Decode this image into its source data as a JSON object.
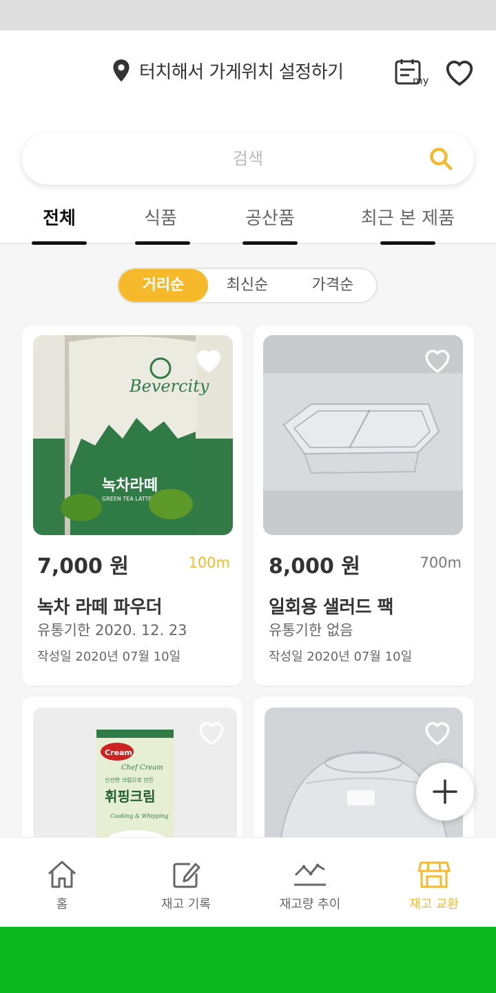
{
  "header": {
    "location_text": "터치해서 가게위치 설정하기",
    "my_icon_label": "my"
  },
  "search": {
    "placeholder": "검색"
  },
  "tabs": [
    {
      "label": "전체",
      "active": true
    },
    {
      "label": "식품",
      "active": false
    },
    {
      "label": "공산품",
      "active": false
    },
    {
      "label": "최근 본 제품",
      "active": false
    }
  ],
  "sort": [
    {
      "label": "거리순",
      "active": true
    },
    {
      "label": "최신순",
      "active": false
    },
    {
      "label": "가격순",
      "active": false
    }
  ],
  "products": [
    {
      "price": "7,000 원",
      "distance": "100m",
      "distance_color": "#f6b92b",
      "title": "녹차 라떼 파우더",
      "expiry": "유통기한 2020. 12. 23",
      "written": "작성일 2020년 07월 10일",
      "image_text": {
        "brand": "Bevercity",
        "product": "녹차라떼",
        "sub": "GREEN TEA LATTE"
      },
      "liked": true
    },
    {
      "price": "8,000 원",
      "distance": "700m",
      "distance_color": "#777777",
      "title": "일회용 샐러드 팩",
      "expiry": "유통기한 없음",
      "written": "작성일 2020년 07월 10일",
      "liked": false
    },
    {
      "image_text": {
        "brand": "Cream",
        "product": "휘핑크림",
        "line1": "Chef Cream",
        "line2": "신선한 크림으로 만든",
        "line3": "Cooking & Whipping"
      },
      "liked": false
    },
    {
      "liked": false
    }
  ],
  "fab": {
    "icon": "plus-icon"
  },
  "nav": [
    {
      "label": "홈",
      "icon": "home-icon",
      "active": false
    },
    {
      "label": "재고 기록",
      "icon": "edit-icon",
      "active": false
    },
    {
      "label": "재고량 추이",
      "icon": "trend-icon",
      "active": false
    },
    {
      "label": "재고 교환",
      "icon": "store-icon",
      "active": true
    }
  ],
  "colors": {
    "accent": "#f6b92b",
    "bottom_bar": "#0cb81f",
    "text": "#333333"
  }
}
